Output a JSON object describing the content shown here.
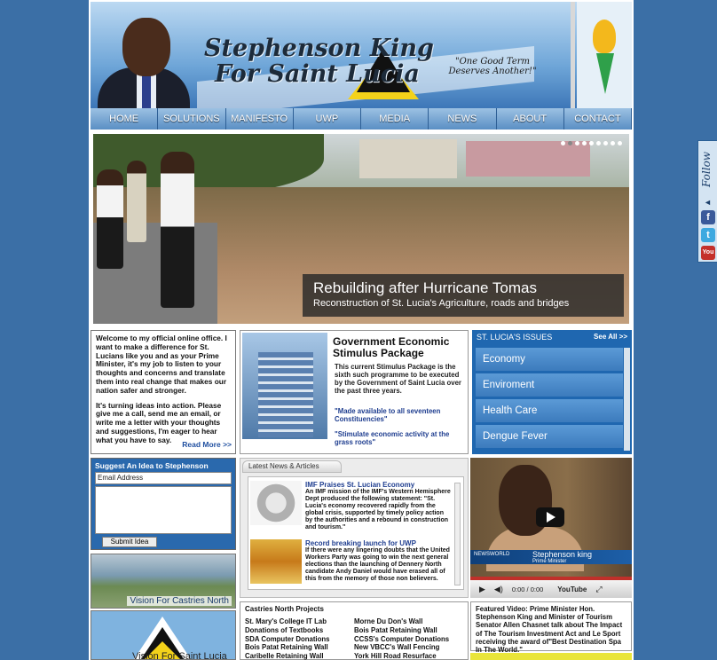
{
  "header": {
    "title_line1": "Stephenson King",
    "title_line2": "For Saint Lucia",
    "slogan_line1": "\"One Good Term",
    "slogan_line2": "Deserves Another!\""
  },
  "nav": [
    "HOME",
    "SOLUTIONS",
    "MANIFESTO",
    "UWP",
    "MEDIA",
    "NEWS",
    "ABOUT",
    "CONTACT"
  ],
  "hero": {
    "caption_title": "Rebuilding after Hurricane Tomas",
    "caption_sub": "Reconstruction of St. Lucia's Agriculture, roads and bridges",
    "slides_total": 9,
    "slide_active": 1
  },
  "welcome": {
    "para1": "Welcome to my official online office. I want to make a difference for St. Lucians like you and as your Prime Minister, it's my job to listen to your thoughts and concerns and translate them into real change that makes our nation safer and stronger.",
    "para2": "It's turning ideas into action. Please give me a call, send me an email, or write me a letter with your thoughts and suggestions, I'm eager to hear what you have to say.",
    "read_more": "Read More >>"
  },
  "stimulus": {
    "title": "Government Economic Stimulus Package",
    "body": "This current Stimulus Package is the sixth such programme to be executed by the Government of Saint Lucia over the past three years.",
    "quote1": "\"Made available to all seventeen Constituencies\"",
    "quote2": "\"Stimulate economic activity at the grass roots\""
  },
  "issues": {
    "heading": "ST. LUCIA'S ISSUES",
    "see_all": "See All >>",
    "items": [
      "Economy",
      "Enviroment",
      "Health Care",
      "Dengue Fever"
    ]
  },
  "suggest": {
    "heading": "Suggest An Idea to Stephenson",
    "email_value": "Email Address",
    "submit": "Submit Idea"
  },
  "vision": {
    "castries": "Vision For Castries North",
    "saint_lucia": "Vision For Saint Lucia"
  },
  "news": {
    "tab": "Latest News & Articles",
    "items": [
      {
        "title": "IMF Praises St. Lucian Economy",
        "text": "An IMF mission of the IMF's Western Hemisphere Dept produced the following statement: \"St. Lucia's economy recovered rapidly from the global crisis, supported by timely policy action by the authorities and a rebound in construction and tourism.\""
      },
      {
        "title": "Record breaking launch for UWP",
        "text": "If there were any lingering doubts that the United Workers Party was going to win the next general elections than the launching of Dennery North candidate Andy Daniel would have erased all of this from the memory of those non believers."
      }
    ]
  },
  "castries": {
    "heading": "Castries North Projects",
    "col1": [
      "St. Mary's College IT Lab",
      "Donations of Textbooks",
      "SDA Computer Donations",
      "Bois Patat Retaining Wall",
      "Caribelle Retaining Wall"
    ],
    "col2": [
      "Morne Du Don's Wall",
      "Bois Patat Retaining Wall",
      "CCSS's Computer Donations",
      "New VBCC's Wall Fencing",
      "York Hill Road Resurface"
    ]
  },
  "video": {
    "name": "Stephenson king",
    "role": "Prime Minister",
    "channel": "NEWSWORLD",
    "time": "0:00 / 0:00",
    "progress": 0
  },
  "feature": {
    "text": "Featured Video: Prime Minister Hon. Stephenson King and Minister of Tourism Senator Allen Chasnet talk about The Impact of The Tourism Investment Act and Le Sport receiving the award of\"Best Destination Spa In The World.\""
  },
  "follow": {
    "label": "Follow",
    "arrow": "◄"
  },
  "icons": {
    "facebook": "facebook-icon",
    "twitter": "twitter-icon",
    "youtube": "youtube-icon"
  },
  "colors": {
    "background": "#3b6fa6",
    "nav": "#5a8fc4",
    "issues": "#1f67b0",
    "link": "#1e3d8f"
  }
}
